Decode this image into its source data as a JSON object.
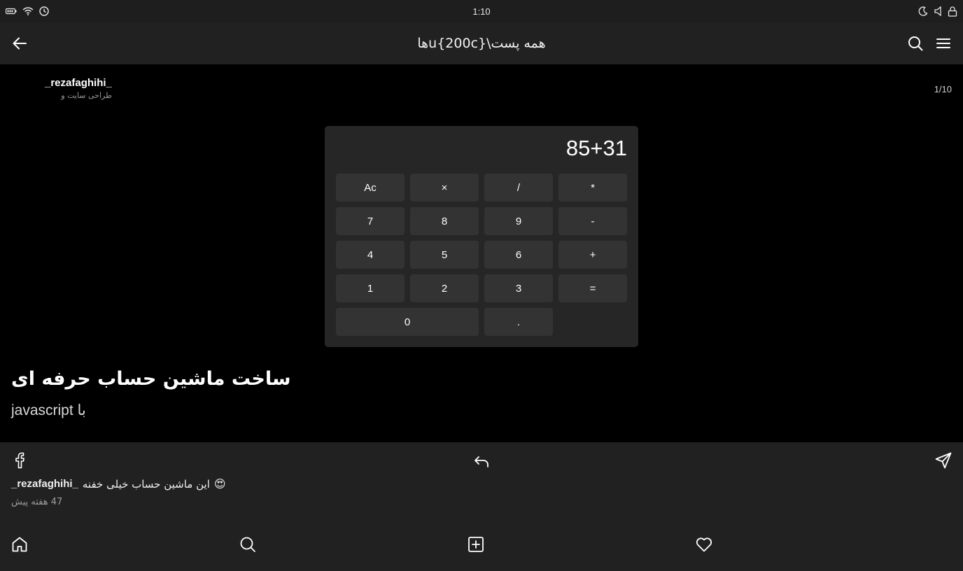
{
  "status_bar": {
    "time": "1:10",
    "left_icons": [
      "battery-icon",
      "wifi-icon",
      "alarm-clock-icon"
    ],
    "right_icons": [
      "moon-icon",
      "volume-muted-icon",
      "lock-icon"
    ]
  },
  "app_bar": {
    "title": "همه پست\\u{200c}ها",
    "icons": [
      "back-arrow-icon",
      "search-icon",
      "menu-icon"
    ]
  },
  "post": {
    "author": "_rezafaghihi_",
    "author_subtitle": "طراحی سایت و",
    "counter": "1/10",
    "title": "ساخت ماشین حساب حرفه ای",
    "subtitle": "با javascript"
  },
  "calculator": {
    "display": "85+31",
    "rows": [
      [
        "Ac",
        "×",
        "/",
        "*"
      ],
      [
        "7",
        "8",
        "9",
        "-"
      ],
      [
        "4",
        "5",
        "6",
        "+"
      ],
      [
        "1",
        "2",
        "3",
        "="
      ],
      [
        "0",
        "."
      ]
    ]
  },
  "comment": {
    "author": "_rezafaghihi_",
    "text": "این ماشین حساب خیلی خفنه",
    "emoji": "😍",
    "time": "47 هفته پیش"
  },
  "colors": {
    "background": "#000000",
    "bars": "#212121",
    "calc_panel": "#262626",
    "calc_key": "#333333"
  }
}
